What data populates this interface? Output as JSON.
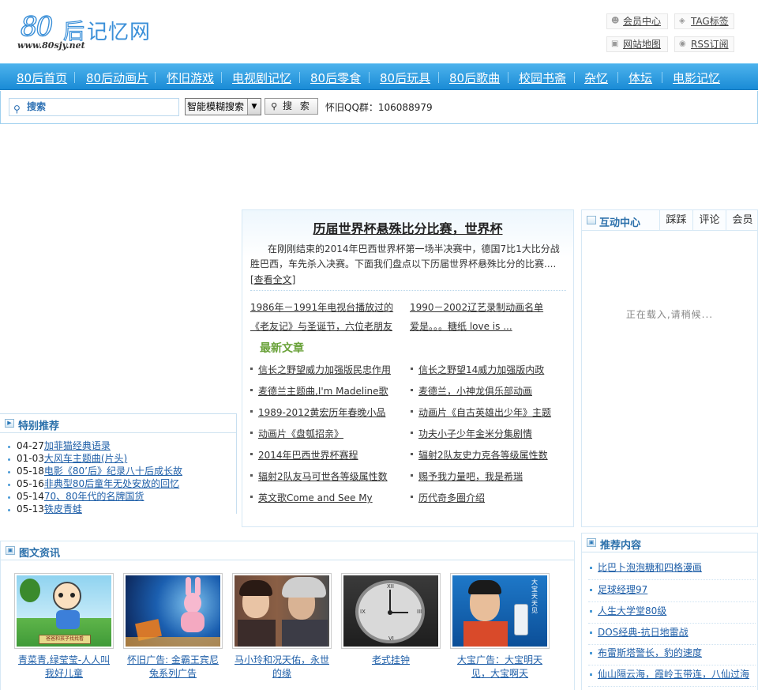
{
  "logo": {
    "num": "80",
    "hou": "后",
    "name": "记忆网",
    "url": "www.80sjy.net"
  },
  "toplinks": [
    {
      "label": "会员中心",
      "icon": "user-icon"
    },
    {
      "label": "TAG标签",
      "icon": "tag-icon"
    },
    {
      "label": "网站地图",
      "icon": "map-icon"
    },
    {
      "label": "RSS订阅",
      "icon": "rss-icon"
    }
  ],
  "nav": [
    "80后首页",
    "80后动画片",
    "怀旧游戏",
    "电视剧记忆",
    "80后零食",
    "80后玩具",
    "80后歌曲",
    "校园书斋",
    "杂忆",
    "体坛",
    "电影记忆"
  ],
  "search": {
    "placeholder": "搜索",
    "mode": "智能模糊搜索",
    "button": "搜 索",
    "qq": "怀旧QQ群：106088979"
  },
  "featured": {
    "title": "历届世界杯悬殊比分比赛，世界杯",
    "summary": "在刚刚结束的2014年巴西世界杯第一场半决赛中，德国7比1大比分战胜巴西，车先杀入决赛。下面我们盘点以下历届世界杯悬殊比分的比赛....",
    "more": "[查看全文]",
    "headlines": [
      [
        "1986年－1991年电视台播放过的",
        "1990－2002辽艺录制动画名单"
      ],
      [
        "《老友记》与圣诞节，六位老朋友",
        "爱是。。。糖纸 love is ..."
      ]
    ]
  },
  "latest": {
    "title": "最新文章",
    "left": [
      "信长之野望威力加强版民忠作用",
      "麦德兰主题曲,I'm Madeline歌",
      "1989-2012黄宏历年春晚小品",
      "动画片《盘瓠招亲》",
      "2014年巴西世界杯赛程",
      "辐射2队友马可世各等级属性数",
      "英文歌Come and See My"
    ],
    "right": [
      "信长之野望14威力加强版内政",
      "麦德兰，小神龙俱乐部动画",
      "动画片《自古英雄出少年》主题",
      "功夫小子少年金米分集剧情",
      "辐射2队友史力克各等级属性数",
      "赐予我力量吧，我是希瑞",
      "历代奇多圈介绍"
    ]
  },
  "special": {
    "title": "特别推荐",
    "items": [
      {
        "date": "04-27",
        "text": "加菲猫经典语录"
      },
      {
        "date": "01-03",
        "text": "大风车主题曲(片头)"
      },
      {
        "date": "05-18",
        "text": "电影《80’后》纪录八十后成长故"
      },
      {
        "date": "05-16",
        "text": "非典型80后童年无处安放的回忆"
      },
      {
        "date": "05-14",
        "text": "70、80年代的名牌国货"
      },
      {
        "date": "05-13",
        "text": "铁皮青蛙"
      }
    ]
  },
  "interact": {
    "title": "互动中心",
    "tabs": [
      "踩踩",
      "评论",
      "会员"
    ],
    "loading": "正在载入,请稍候..."
  },
  "photo": {
    "title": "图文资讯",
    "items": [
      {
        "caption": "青菜青,绿莹莹-人人叫我好儿童",
        "image_text": "爸爸和孩子找找看"
      },
      {
        "caption": "怀旧广告: 金霸王宾尼兔系列广告",
        "image_text": ""
      },
      {
        "caption": "马小玲和况天佑，永世的缘",
        "image_text": ""
      },
      {
        "caption": "老式挂钟",
        "image_text": ""
      },
      {
        "caption": "大宝广告：大宝明天见，大宝啊天",
        "image_text": "大宝天天见"
      }
    ]
  },
  "recommend": {
    "title": "推荐内容",
    "items": [
      "比巴卜泡泡糖和四格漫画",
      "足球经理97",
      "人生大学堂80级",
      "DOS经典-抗日地雷战",
      "布雷斯塔警长，豹的速度",
      "仙山隔云海，霞岭玉带连，八仙过海"
    ]
  }
}
